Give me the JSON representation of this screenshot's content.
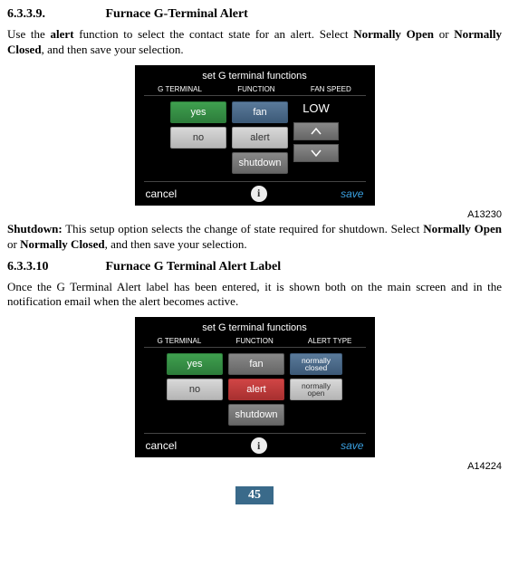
{
  "section1": {
    "number": "6.3.3.9.",
    "title": "Furnace G-Terminal Alert",
    "para_parts": {
      "p1": "Use the ",
      "b1": "alert",
      "p2": " function to select the contact state for an alert. Select ",
      "b2": "Normally Open",
      "p3": " or ",
      "b3": "Normally Closed",
      "p4": ", and then save your selection."
    }
  },
  "screenshot1": {
    "title": "set G terminal functions",
    "headers": {
      "h1": "G TERMINAL",
      "h2": "FUNCTION",
      "h3": "FAN SPEED"
    },
    "col1": {
      "yes": "yes",
      "no": "no"
    },
    "col2": {
      "fan": "fan",
      "alert": "alert",
      "shutdown": "shutdown"
    },
    "col3": {
      "low": "LOW"
    },
    "footer": {
      "cancel": "cancel",
      "info": "i",
      "save": "save"
    },
    "fig_id": "A13230"
  },
  "shutdown_para": {
    "label": "Shutdown:",
    "p1": " This setup option selects the change of state required for shutdown. Select ",
    "b1": "Normally Open",
    "p2": " or ",
    "b2": "Normally Closed",
    "p3": ", and then save your selection."
  },
  "section2": {
    "number": "6.3.3.10",
    "title": "Furnace G Terminal Alert Label",
    "para": "Once the G Terminal Alert label has been entered, it is shown both on the main screen and in the notification email when the alert becomes active."
  },
  "screenshot2": {
    "title": "set G terminal functions",
    "headers": {
      "h1": "G TERMINAL",
      "h2": "FUNCTION",
      "h3": "ALERT TYPE"
    },
    "col1": {
      "yes": "yes",
      "no": "no"
    },
    "col2": {
      "fan": "fan",
      "alert": "alert",
      "shutdown": "shutdown"
    },
    "col3": {
      "closed_l1": "normally",
      "closed_l2": "closed",
      "open_l1": "normally",
      "open_l2": "open"
    },
    "footer": {
      "cancel": "cancel",
      "info": "i",
      "save": "save"
    },
    "fig_id": "A14224"
  },
  "page_number": "45"
}
